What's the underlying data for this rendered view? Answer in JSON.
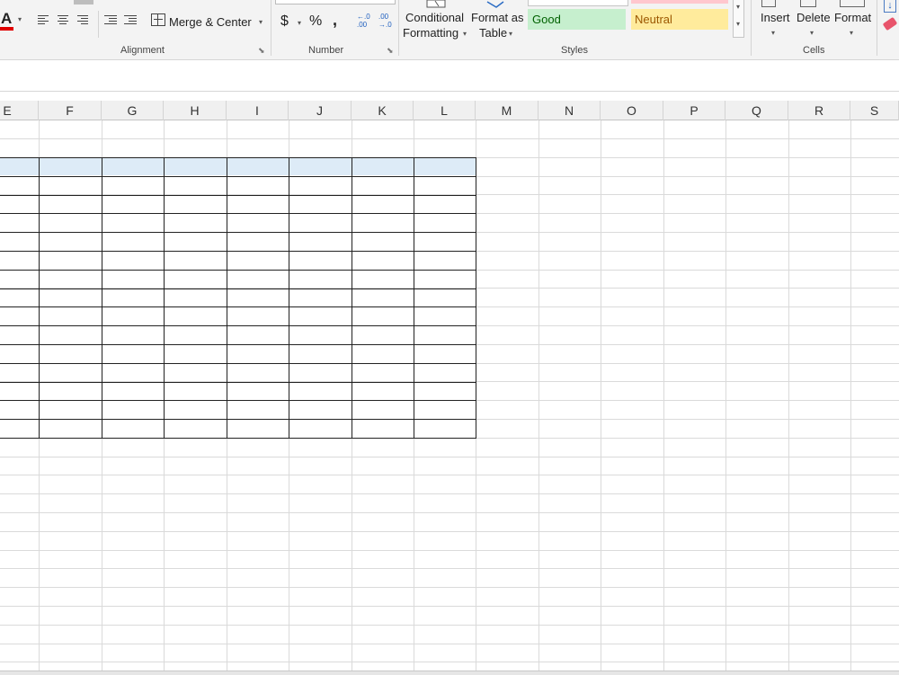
{
  "ribbon": {
    "groups": {
      "alignment": "Alignment",
      "number": "Number",
      "styles": "Styles",
      "cells": "Cells"
    },
    "font_color_letter": "A",
    "merge_center_label": "Merge & Center",
    "number_buttons": {
      "currency": "$",
      "percent": "%",
      "comma": ",",
      "increase_decimal": "←.0\n.00",
      "decrease_decimal": ".00\n→.0"
    },
    "conditional_formatting": [
      "Conditional",
      "Formatting"
    ],
    "format_as_table": [
      "Format as",
      "Table"
    ],
    "styles": {
      "good": "Good",
      "neutral": "Neutral",
      "good_fill": "#c6efce",
      "neutral_fill": "#ffeb9c",
      "bad_fill": "#ffc7ce"
    },
    "cells_buttons": [
      "Insert",
      "Delete",
      "Format"
    ],
    "caret": "▾"
  },
  "sheet": {
    "columns": [
      "E",
      "F",
      "G",
      "H",
      "I",
      "J",
      "K",
      "L",
      "M",
      "N",
      "O",
      "P",
      "Q",
      "R",
      "S"
    ],
    "table_header_fill": "#ddebf7"
  }
}
